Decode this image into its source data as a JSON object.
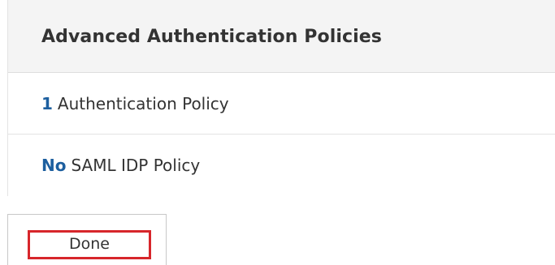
{
  "panel": {
    "title": "Advanced Authentication Policies",
    "rows": [
      {
        "value": "1",
        "label": "Authentication Policy"
      },
      {
        "value": "No",
        "label": "SAML IDP Policy"
      }
    ]
  },
  "actions": {
    "done_label": "Done"
  },
  "colors": {
    "header_background": "#f4f4f4",
    "value_blue": "#1d5f9f",
    "highlight_red": "#d7262b",
    "text": "#333333"
  }
}
